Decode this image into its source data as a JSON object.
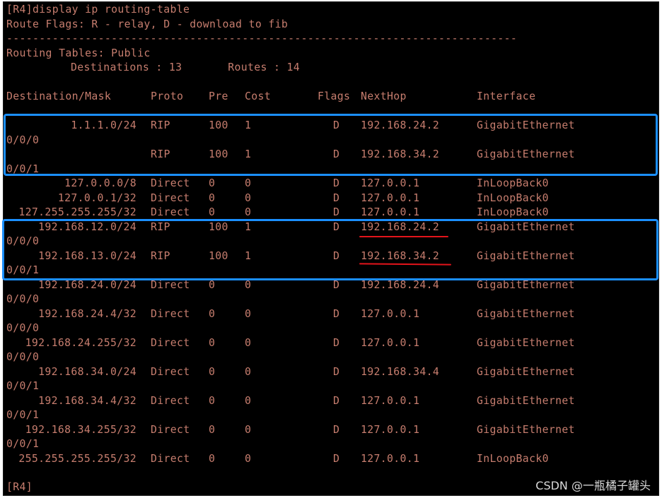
{
  "terminal": {
    "command_prompt": "[R4]display ip routing-table",
    "route_flags": "Route Flags: R - relay, D - download to fib",
    "separator": "------------------------------------------------------------------------------",
    "table_name": "Routing Tables: Public",
    "summary": "Destinations : 13       Routes : 14",
    "headers": {
      "destination": "Destination/Mask",
      "proto": "Proto",
      "pre": "Pre",
      "cost": "Cost",
      "flags": "Flags",
      "nexthop": "NextHop",
      "interface": "Interface"
    },
    "routes": [
      {
        "dest": "1.1.1.0/24",
        "proto": "RIP",
        "pre": "100",
        "cost": "1",
        "flags": "D",
        "nexthop": "192.168.24.2",
        "iface": "GigabitEthernet",
        "iface_cont": "0/0/0"
      },
      {
        "dest": "",
        "proto": "RIP",
        "pre": "100",
        "cost": "1",
        "flags": "D",
        "nexthop": "192.168.34.2",
        "iface": "GigabitEthernet",
        "iface_cont": "0/0/1"
      },
      {
        "dest": "127.0.0.0/8",
        "proto": "Direct",
        "pre": "0",
        "cost": "0",
        "flags": "D",
        "nexthop": "127.0.0.1",
        "iface": "InLoopBack0",
        "iface_cont": ""
      },
      {
        "dest": "127.0.0.1/32",
        "proto": "Direct",
        "pre": "0",
        "cost": "0",
        "flags": "D",
        "nexthop": "127.0.0.1",
        "iface": "InLoopBack0",
        "iface_cont": ""
      },
      {
        "dest": "127.255.255.255/32",
        "proto": "Direct",
        "pre": "0",
        "cost": "0",
        "flags": "D",
        "nexthop": "127.0.0.1",
        "iface": "InLoopBack0",
        "iface_cont": ""
      },
      {
        "dest": "192.168.12.0/24",
        "proto": "RIP",
        "pre": "100",
        "cost": "1",
        "flags": "D",
        "nexthop": "192.168.24.2",
        "iface": "GigabitEthernet",
        "iface_cont": "0/0/0"
      },
      {
        "dest": "192.168.13.0/24",
        "proto": "RIP",
        "pre": "100",
        "cost": "1",
        "flags": "D",
        "nexthop": "192.168.34.2",
        "iface": "GigabitEthernet",
        "iface_cont": "0/0/1"
      },
      {
        "dest": "192.168.24.0/24",
        "proto": "Direct",
        "pre": "0",
        "cost": "0",
        "flags": "D",
        "nexthop": "192.168.24.4",
        "iface": "GigabitEthernet",
        "iface_cont": "0/0/0"
      },
      {
        "dest": "192.168.24.4/32",
        "proto": "Direct",
        "pre": "0",
        "cost": "0",
        "flags": "D",
        "nexthop": "127.0.0.1",
        "iface": "GigabitEthernet",
        "iface_cont": "0/0/0"
      },
      {
        "dest": "192.168.24.255/32",
        "proto": "Direct",
        "pre": "0",
        "cost": "0",
        "flags": "D",
        "nexthop": "127.0.0.1",
        "iface": "GigabitEthernet",
        "iface_cont": "0/0/0"
      },
      {
        "dest": "192.168.34.0/24",
        "proto": "Direct",
        "pre": "0",
        "cost": "0",
        "flags": "D",
        "nexthop": "192.168.34.4",
        "iface": "GigabitEthernet",
        "iface_cont": "0/0/1"
      },
      {
        "dest": "192.168.34.4/32",
        "proto": "Direct",
        "pre": "0",
        "cost": "0",
        "flags": "D",
        "nexthop": "127.0.0.1",
        "iface": "GigabitEthernet",
        "iface_cont": "0/0/1"
      },
      {
        "dest": "192.168.34.255/32",
        "proto": "Direct",
        "pre": "0",
        "cost": "0",
        "flags": "D",
        "nexthop": "127.0.0.1",
        "iface": "GigabitEthernet",
        "iface_cont": "0/0/1"
      },
      {
        "dest": "255.255.255.255/32",
        "proto": "Direct",
        "pre": "0",
        "cost": "0",
        "flags": "D",
        "nexthop": "127.0.0.1",
        "iface": "InLoopBack0",
        "iface_cont": ""
      }
    ],
    "final_prompt": "[R4]"
  },
  "annotations": {
    "box_color": "#1b8fff",
    "underline_color": "#e3141b"
  },
  "watermark": "CSDN @一瓶橘子罐头",
  "colors": {
    "terminal_bg": "#000000",
    "terminal_text": "#c67d6e"
  }
}
